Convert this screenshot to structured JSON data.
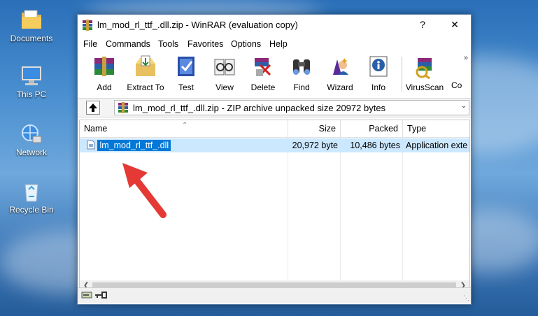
{
  "desktop": {
    "icons": [
      {
        "label": "Documents"
      },
      {
        "label": "This PC"
      },
      {
        "label": "Network"
      },
      {
        "label": "Recycle Bin"
      }
    ]
  },
  "window": {
    "title": "lm_mod_rl_ttf_.dll.zip - WinRAR (evaluation copy)",
    "help_btn": "?",
    "close_btn": "✕"
  },
  "menu": [
    "File",
    "Commands",
    "Tools",
    "Favorites",
    "Options",
    "Help"
  ],
  "toolbar": {
    "buttons": [
      "Add",
      "Extract To",
      "Test",
      "View",
      "Delete",
      "Find",
      "Wizard",
      "Info",
      "VirusScan",
      "Co"
    ],
    "more": "»"
  },
  "address": {
    "text": "lm_mod_rl_ttf_.dll.zip - ZIP archive unpacked size 20972 bytes"
  },
  "columns": {
    "name": "Name",
    "size": "Size",
    "packed": "Packed",
    "type": "Type"
  },
  "files": [
    {
      "name": "lm_mod_rl_ttf_.dll",
      "size": "20,972 byte",
      "packed": "10,486 bytes",
      "type": "Application exte"
    }
  ],
  "colors": {
    "selection": "#0078d7",
    "row_highlight": "#cce8ff",
    "arrow": "#e53935"
  }
}
